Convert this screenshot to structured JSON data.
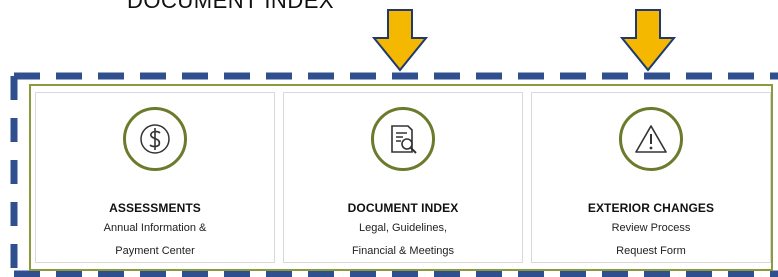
{
  "heading": "DOCUMENT INDEX",
  "colors": {
    "accent": "#6b7b2c",
    "arrow": "#f5b800",
    "dash": "#2f4f8f"
  },
  "cards": [
    {
      "icon": "dollar-icon",
      "title": "ASSESSMENTS",
      "line1": "Annual Information &",
      "line2": "Payment Center"
    },
    {
      "icon": "document-search-icon",
      "title": "DOCUMENT INDEX",
      "line1": "Legal, Guidelines,",
      "line2": "Financial & Meetings"
    },
    {
      "icon": "warning-icon",
      "title": "EXTERIOR CHANGES",
      "line1": "Review Process",
      "line2": "Request Form"
    }
  ]
}
